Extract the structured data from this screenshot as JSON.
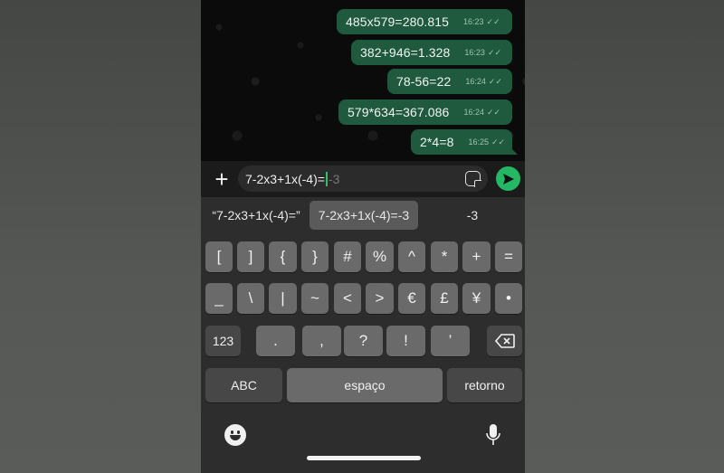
{
  "chat": {
    "messages": [
      {
        "text": "485x579=280.815",
        "time": "16:23"
      },
      {
        "text": "382+946=1.328",
        "time": "16:23"
      },
      {
        "text": "78-56=22",
        "time": "16:24"
      },
      {
        "text": "579*634=367.086",
        "time": "16:24"
      },
      {
        "text": "2*4=8",
        "time": "16:25"
      }
    ],
    "read_ticks": "✓✓"
  },
  "composer": {
    "typed": "7-2x3+1x(-4)=",
    "ghost": "-3",
    "plus_label": "+"
  },
  "keyboard": {
    "suggestions": [
      "“7-2x3+1x(-4)=”",
      "7-2x3+1x(-4)=-3",
      "-3"
    ],
    "row1": [
      "[",
      "]",
      "{",
      "}",
      "#",
      "%",
      "^",
      "*",
      "+",
      "="
    ],
    "row2": [
      "_",
      "\\",
      "|",
      "~",
      "<",
      ">",
      "€",
      "£",
      "¥",
      "•"
    ],
    "row3_left": "123",
    "row3": [
      ".",
      ",",
      "?",
      "!",
      "’"
    ],
    "abc": "ABC",
    "space": "espaço",
    "return": "retorno"
  },
  "colors": {
    "bubble": "#1f5a3f",
    "send": "#25b864",
    "cursor": "#2fbf71"
  },
  "icons": {
    "backspace": "backspace-icon",
    "emoji": "emoji-icon",
    "mic": "microphone-icon",
    "sticker": "sticker-icon",
    "send": "send-icon"
  }
}
